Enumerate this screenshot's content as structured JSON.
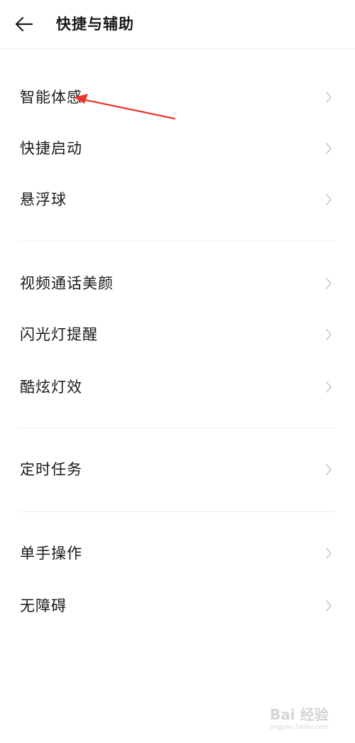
{
  "header": {
    "back_icon": "arrow-left-icon",
    "title": "快捷与辅助"
  },
  "groups": [
    {
      "items": [
        {
          "label": "智能体感"
        },
        {
          "label": "快捷启动"
        },
        {
          "label": "悬浮球"
        }
      ]
    },
    {
      "items": [
        {
          "label": "视频通话美颜"
        },
        {
          "label": "闪光灯提醒"
        },
        {
          "label": "酷炫灯效"
        }
      ]
    },
    {
      "items": [
        {
          "label": "定时任务"
        }
      ]
    },
    {
      "items": [
        {
          "label": "单手操作"
        },
        {
          "label": "无障碍"
        }
      ]
    }
  ],
  "item_chevron_icon": "chevron-right-icon",
  "annotation": {
    "color": "#e8352b"
  },
  "watermark": {
    "logo": "Bai 经验",
    "url": "jingyan.baidu.com"
  },
  "colors": {
    "background": "#ffffff",
    "text": "#1a1a1a",
    "chevron": "#c4c4c4",
    "divider": "#ededed"
  }
}
